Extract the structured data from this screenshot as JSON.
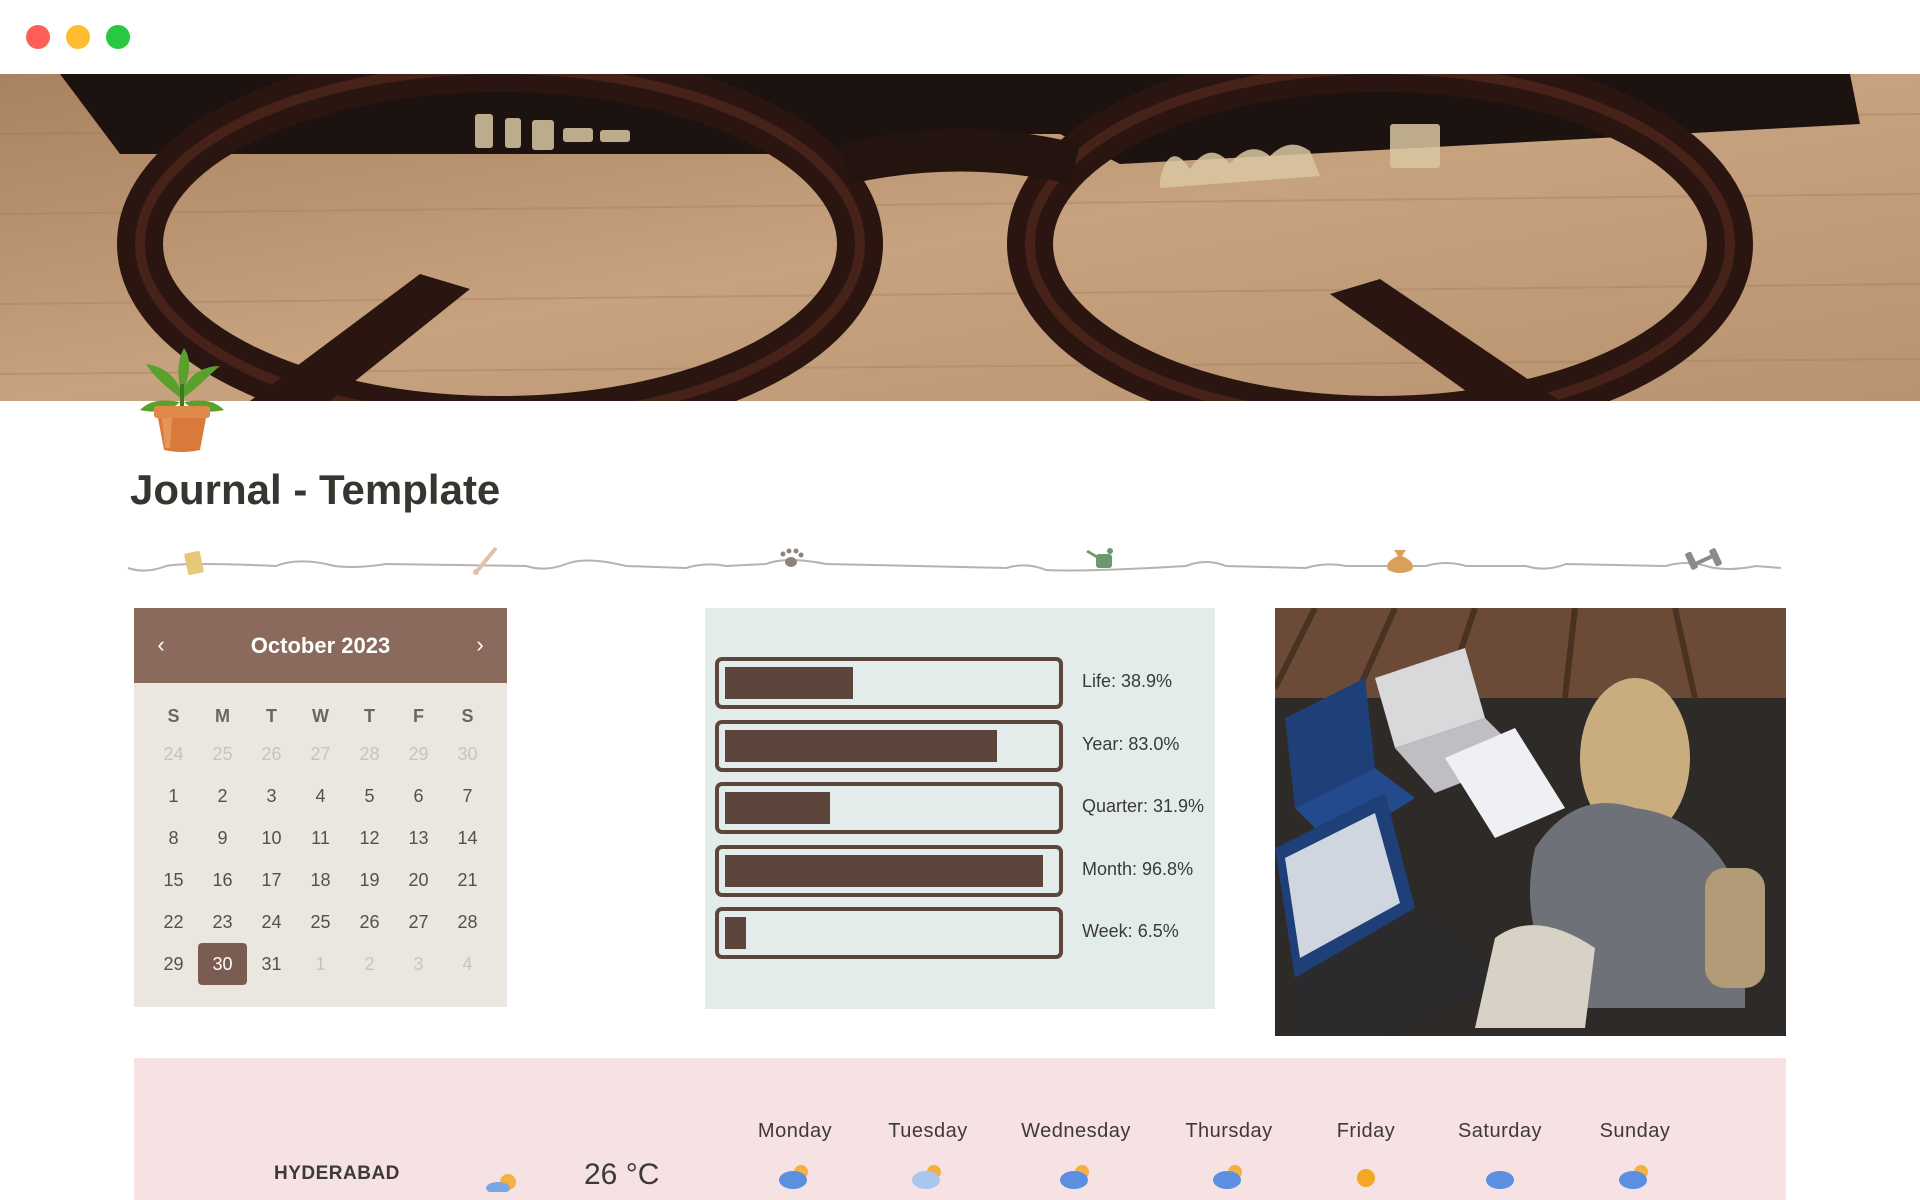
{
  "window": {
    "controls": [
      "close",
      "minimize",
      "maximize"
    ]
  },
  "page": {
    "title": "Journal - Template",
    "icon": "potted-plant-icon"
  },
  "divider": {
    "icons": [
      "note-icon",
      "brush-icon",
      "paw-icon",
      "watering-can-icon",
      "money-bag-icon",
      "dumbbell-icon"
    ]
  },
  "calendar": {
    "month_label": "October 2023",
    "prev": "‹",
    "next": "›",
    "weekdays": [
      "S",
      "M",
      "T",
      "W",
      "T",
      "F",
      "S"
    ],
    "weeks": [
      [
        "24",
        "25",
        "26",
        "27",
        "28",
        "29",
        "30"
      ],
      [
        "1",
        "2",
        "3",
        "4",
        "5",
        "6",
        "7"
      ],
      [
        "8",
        "9",
        "10",
        "11",
        "12",
        "13",
        "14"
      ],
      [
        "15",
        "16",
        "17",
        "18",
        "19",
        "20",
        "21"
      ],
      [
        "22",
        "23",
        "24",
        "25",
        "26",
        "27",
        "28"
      ],
      [
        "29",
        "30",
        "31",
        "1",
        "2",
        "3",
        "4"
      ]
    ],
    "today": "30"
  },
  "progress": [
    {
      "label": "Life: 38.9%",
      "value": 38.9
    },
    {
      "label": "Year: 83.0%",
      "value": 83.0
    },
    {
      "label": "Quarter: 31.9%",
      "value": 31.9
    },
    {
      "label": "Month: 96.8%",
      "value": 96.8
    },
    {
      "label": "Week: 6.5%",
      "value": 6.5
    }
  ],
  "weather": {
    "city": "HYDERABAD",
    "temperature": "26 °C",
    "days": [
      "Monday",
      "Tuesday",
      "Wednesday",
      "Thursday",
      "Friday",
      "Saturday",
      "Sunday"
    ]
  },
  "colors": {
    "calendar_header": "#8a6a5c",
    "progress_bar": "#5c463b",
    "progress_bg": "#e2ecea",
    "weather_bg": "#f6e2e2"
  }
}
